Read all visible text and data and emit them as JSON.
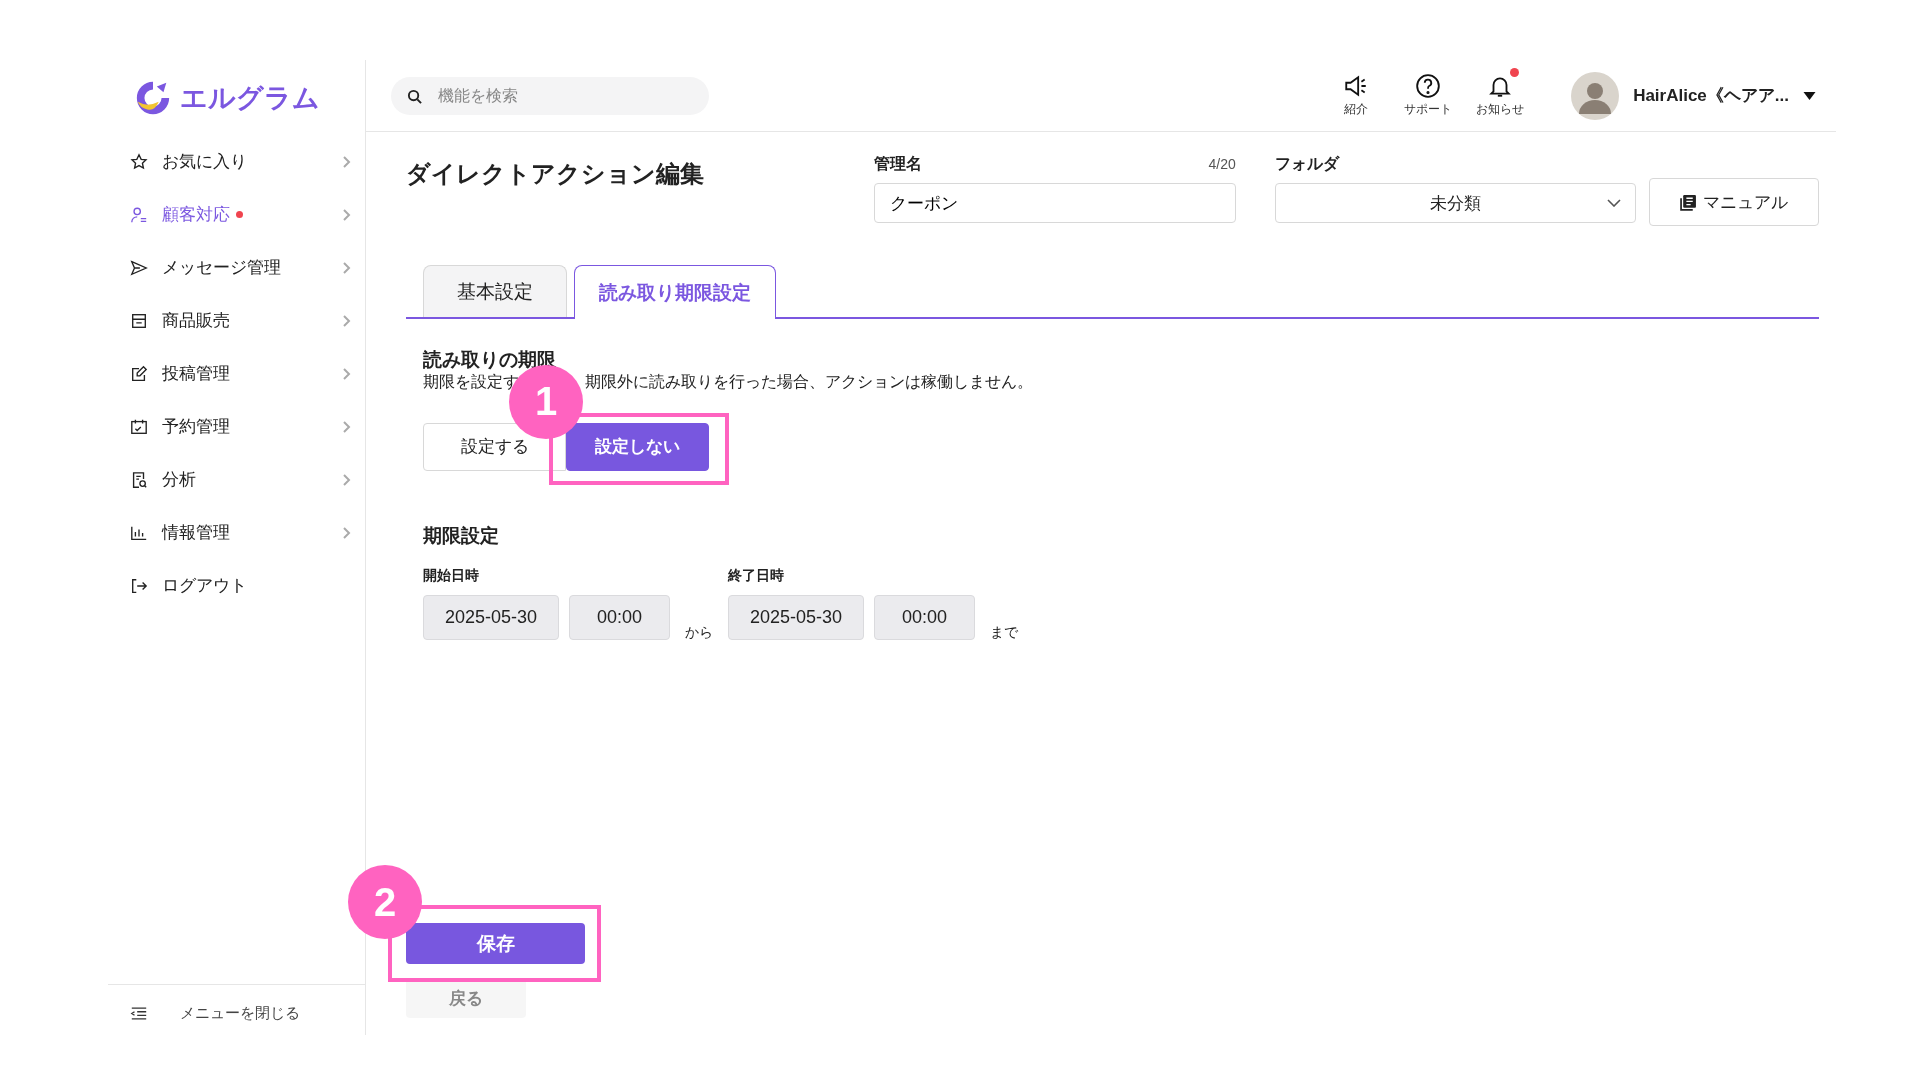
{
  "logo": {
    "text": "エルグラム"
  },
  "sidebar": {
    "items": [
      {
        "label": "お気に入り",
        "kind": "star",
        "selected": false,
        "dot": false,
        "expandable": true
      },
      {
        "label": "顧客対応",
        "kind": "person",
        "selected": true,
        "dot": true,
        "expandable": true
      },
      {
        "label": "メッセージ管理",
        "kind": "send",
        "selected": false,
        "dot": false,
        "expandable": true
      },
      {
        "label": "商品販売",
        "kind": "store",
        "selected": false,
        "dot": false,
        "expandable": true
      },
      {
        "label": "投稿管理",
        "kind": "edit",
        "selected": false,
        "dot": false,
        "expandable": true
      },
      {
        "label": "予約管理",
        "kind": "calendar",
        "selected": false,
        "dot": false,
        "expandable": true
      },
      {
        "label": "分析",
        "kind": "report",
        "selected": false,
        "dot": false,
        "expandable": true
      },
      {
        "label": "情報管理",
        "kind": "chart",
        "selected": false,
        "dot": false,
        "expandable": true
      },
      {
        "label": "ログアウト",
        "kind": "logout",
        "selected": false,
        "dot": false,
        "expandable": false
      }
    ],
    "footer": "メニューを閉じる"
  },
  "header": {
    "search": {
      "placeholder": "機能を検索"
    },
    "icons": [
      {
        "label": "紹介",
        "kind": "megaphone",
        "dot": false
      },
      {
        "label": "サポート",
        "kind": "help",
        "dot": false
      },
      {
        "label": "お知らせ",
        "kind": "bell",
        "dot": true
      }
    ],
    "user": "HairAlice《ヘアア..."
  },
  "page": {
    "title": "ダイレクトアクション編集",
    "name_field": {
      "label": "管理名",
      "counter": "4/20",
      "value": "クーポン"
    },
    "folder": {
      "label": "フォルダ",
      "value": "未分類"
    },
    "manual_button": "マニュアル",
    "tabs": [
      {
        "label": "基本設定",
        "selected": false
      },
      {
        "label": "読み取り期限設定",
        "selected": true
      }
    ],
    "section": {
      "title": "読み取りの期限",
      "description_parts": [
        "期限を設定す",
        "期限外に読み取りを行った場合、アクションは稼働しません。"
      ]
    },
    "toggle": [
      {
        "label": "設定する",
        "selected": false
      },
      {
        "label": "設定しない",
        "selected": true
      }
    ],
    "period": {
      "title": "期限設定",
      "start": {
        "label": "開始日時",
        "date": "2025-05-30",
        "time": "00:00"
      },
      "separator": "から",
      "end": {
        "label": "終了日時",
        "date": "2025-05-30",
        "time": "00:00"
      },
      "suffix": "まで"
    },
    "save_button": "保存",
    "back_button": "戻る"
  },
  "annotations": [
    {
      "number": "1"
    },
    {
      "number": "2"
    }
  ]
}
